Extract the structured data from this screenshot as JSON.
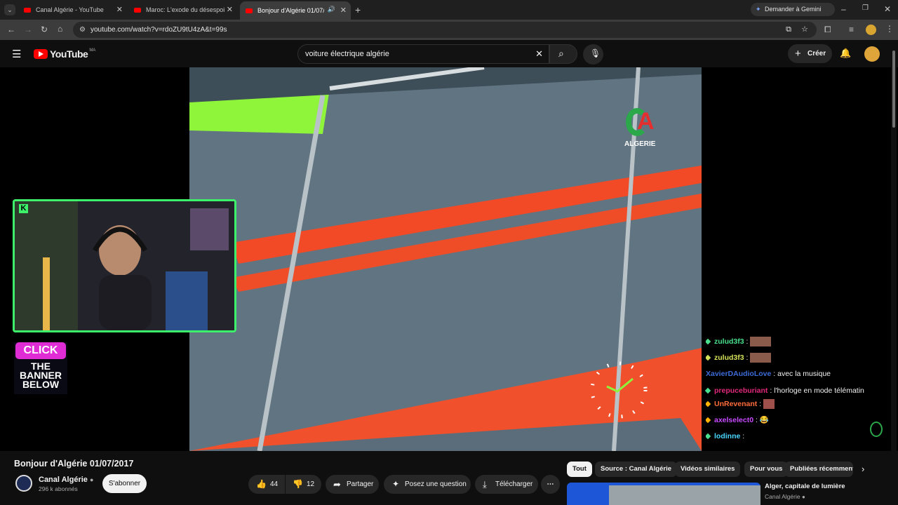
{
  "browser": {
    "tabs": [
      {
        "title": "Canal Algérie - YouTube"
      },
      {
        "title": "Maroc: L'exode du désespoir ve"
      },
      {
        "title": "Bonjour d'Algérie 01/07/20"
      }
    ],
    "gemini_label": "Demander à Gemini",
    "url": "youtube.com/watch?v=rdoZU9tU4zA&t=99s"
  },
  "youtube": {
    "logo_text": "YouTube",
    "country_code": "MA",
    "search_value": "voiture électrique algérie",
    "create_label": "Créer"
  },
  "video": {
    "channel_watermark": "ALGERIE",
    "overlay_banner": [
      "CLICK",
      "THE",
      "BANNER",
      "BELOW"
    ]
  },
  "chat": [
    {
      "user": "zulud3f3",
      "msg": "",
      "color": "#48e08d"
    },
    {
      "user": "zulud3f3",
      "msg": "",
      "color": "#d4e157"
    },
    {
      "user": "XavierDAudioLove",
      "msg": "avec la musique",
      "color": "#3c6bd8"
    },
    {
      "user": "prepuceburiant",
      "msg": "l'horloge en mode télématin",
      "color": "#e0287a"
    },
    {
      "user": "UnRevenant",
      "msg": "",
      "color": "#ff6d3b"
    },
    {
      "user": "axelselect0",
      "msg": "😂",
      "color": "#c84bff"
    },
    {
      "user": "lodinne",
      "msg": "",
      "color": "#49d8ff"
    }
  ],
  "details": {
    "title": "Bonjour d'Algérie 01/07/2017",
    "channel": "Canal Algérie",
    "subscribers": "296 k abonnés",
    "subscribe_label": "S'abonner",
    "likes": "44",
    "dislikes": "12",
    "share_label": "Partager",
    "ask_label": "Posez une question",
    "download_label": "Télécharger"
  },
  "chips": [
    "Tout",
    "Source : Canal Algérie",
    "Vidéos similaires",
    "Pour vous",
    "Publiées récemment"
  ],
  "suggestion": {
    "title": "Alger, capitale de lumière",
    "channel": "Canal Algérie"
  }
}
